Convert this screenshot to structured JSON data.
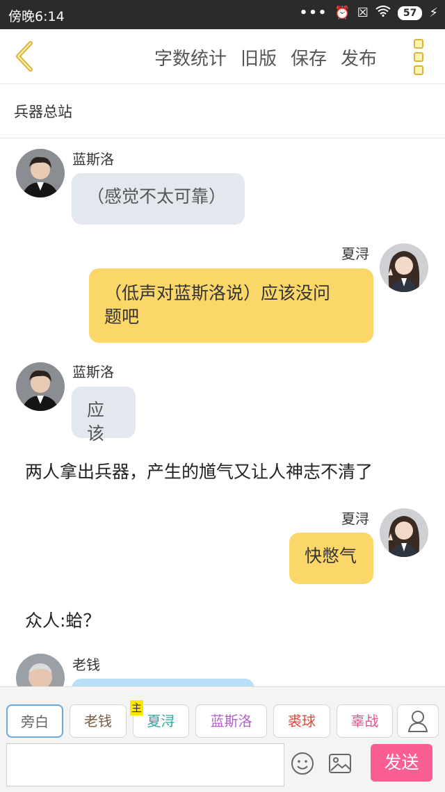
{
  "status_bar": {
    "time": "傍晚6:14",
    "battery": "57"
  },
  "toolbar": {
    "word_count": "字数统计",
    "old_version": "旧版",
    "save": "保存",
    "publish": "发布"
  },
  "chapter_title": "兵器总站",
  "messages": [
    {
      "type": "left",
      "name": "蓝斯洛",
      "text": "（感觉不太可靠）"
    },
    {
      "type": "right",
      "name": "夏浔",
      "lines": [
        "（低声对蓝斯洛说）应该没问",
        "题吧"
      ]
    },
    {
      "type": "left",
      "name": "蓝斯洛",
      "text": "应该"
    },
    {
      "type": "narration",
      "text": "两人拿出兵器，产生的馗气又让人神志不清了"
    },
    {
      "type": "right",
      "name": "夏浔",
      "text": "快憋气"
    },
    {
      "type": "narration",
      "text": "众人:蛤？"
    },
    {
      "type": "left",
      "name": "老钱",
      "text": ""
    }
  ],
  "characters": [
    {
      "label": "旁白",
      "color": "#777777"
    },
    {
      "label": "老钱",
      "color": "#7a5a44"
    },
    {
      "label": "夏浔",
      "color": "#2aa6a0",
      "tag": "主"
    },
    {
      "label": "蓝斯洛",
      "color": "#b160c6"
    },
    {
      "label": "裘球",
      "color": "#d94b3f"
    },
    {
      "label": "辜战",
      "color": "#e0568e"
    }
  ],
  "input": {
    "placeholder": ""
  },
  "send_label": "发送",
  "colors": {
    "accent": "#fb5d95",
    "bubble_right": "#fbd76a",
    "bubble_left": "#e3e8ef"
  }
}
